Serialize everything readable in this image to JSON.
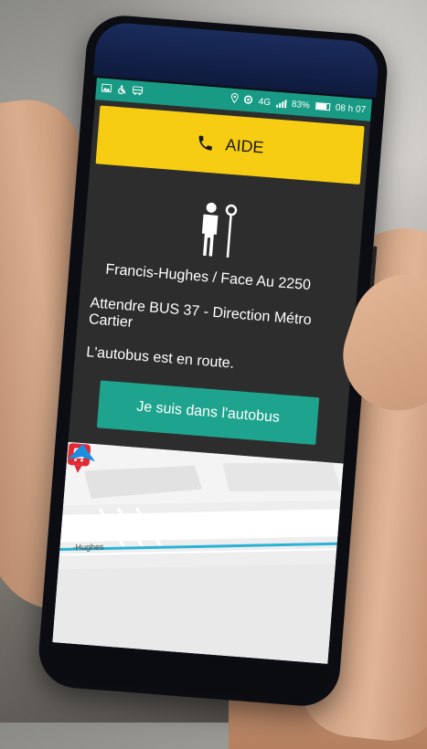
{
  "status_bar": {
    "left_icons": [
      "image-icon",
      "accessibility-icon",
      "bus-icon"
    ],
    "network": "4G",
    "battery_percent": "83%",
    "battery_level": 0.83,
    "time": "08 h 07"
  },
  "help_button": {
    "label": "AIDE",
    "icon": "phone-icon"
  },
  "stop": {
    "icon": "bus-stop-person-icon",
    "name": "Francis-Hughes / Face Au 2250",
    "wait_instruction": "Attendre BUS 37 - Direction Métro Cartier",
    "status": "L'autobus est en route."
  },
  "on_bus_button": {
    "label": "Je suis dans l'autobus"
  },
  "map": {
    "street_label": "-Hughes",
    "marker_icon": "bus-stop-marker-icon",
    "location_icon": "navigation-arrow-icon"
  },
  "colors": {
    "status_bar": "#189a84",
    "help_button": "#f6cd12",
    "on_bus_button": "#1ea48e",
    "screen_bg": "#2d2d2d",
    "route_line": "#2bb3d6",
    "marker": "#e02a34",
    "nav_arrow": "#1a8ee0"
  }
}
